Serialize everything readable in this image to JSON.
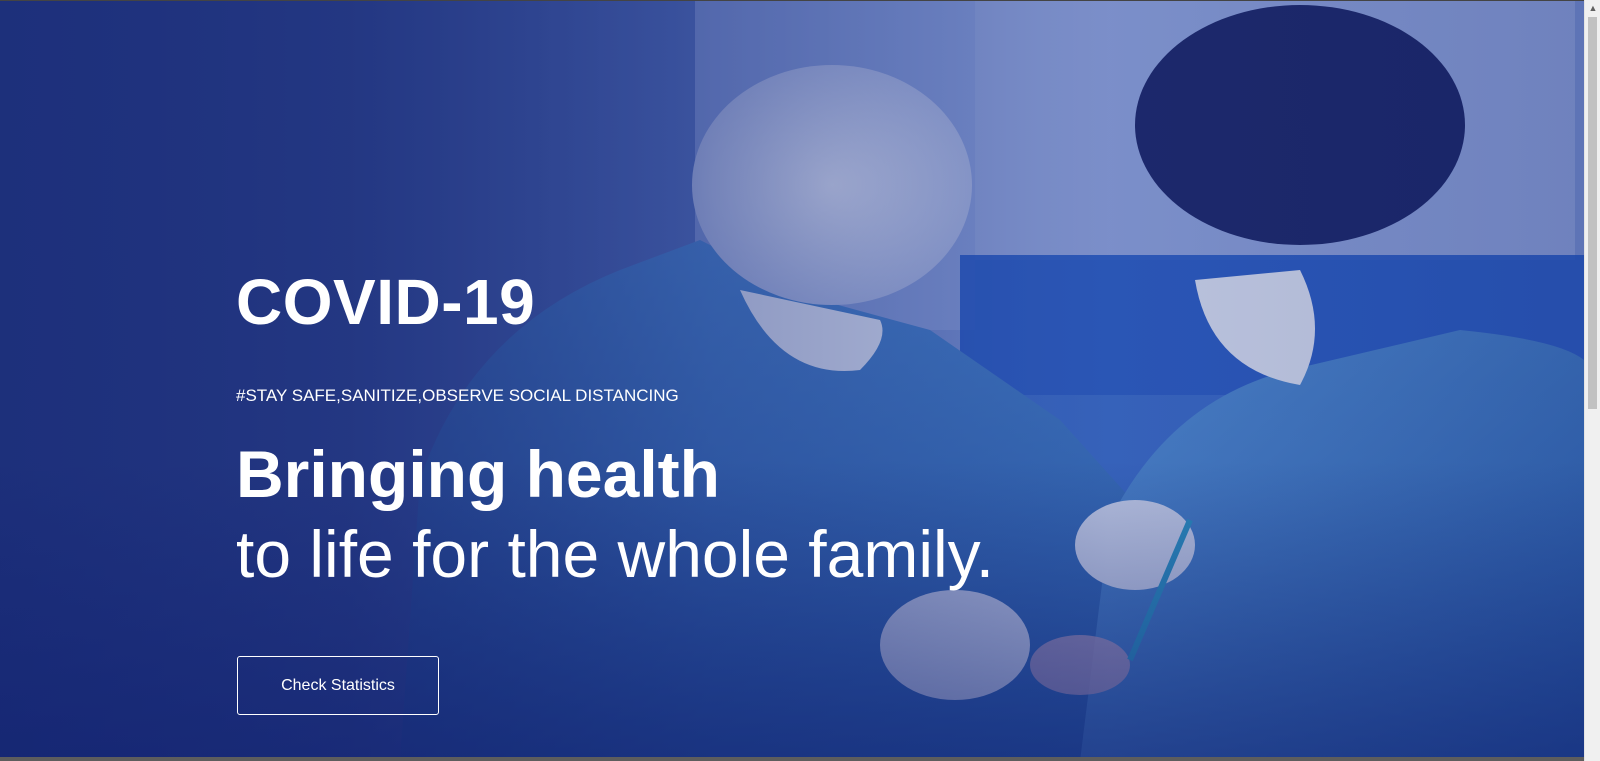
{
  "hero": {
    "title": "COVID-19",
    "tagline": "#STAY SAFE,SANITIZE,OBSERVE SOCIAL DISTANCING",
    "heading": "Bringing health",
    "subheading": "to life for the whole family.",
    "cta_label": "Check Statistics",
    "image_alt": "Surgeons performing an operation"
  },
  "colors": {
    "overlay": "#1b2d78",
    "text": "#ffffff"
  },
  "scrollbar": {
    "up_arrow": "▲"
  }
}
